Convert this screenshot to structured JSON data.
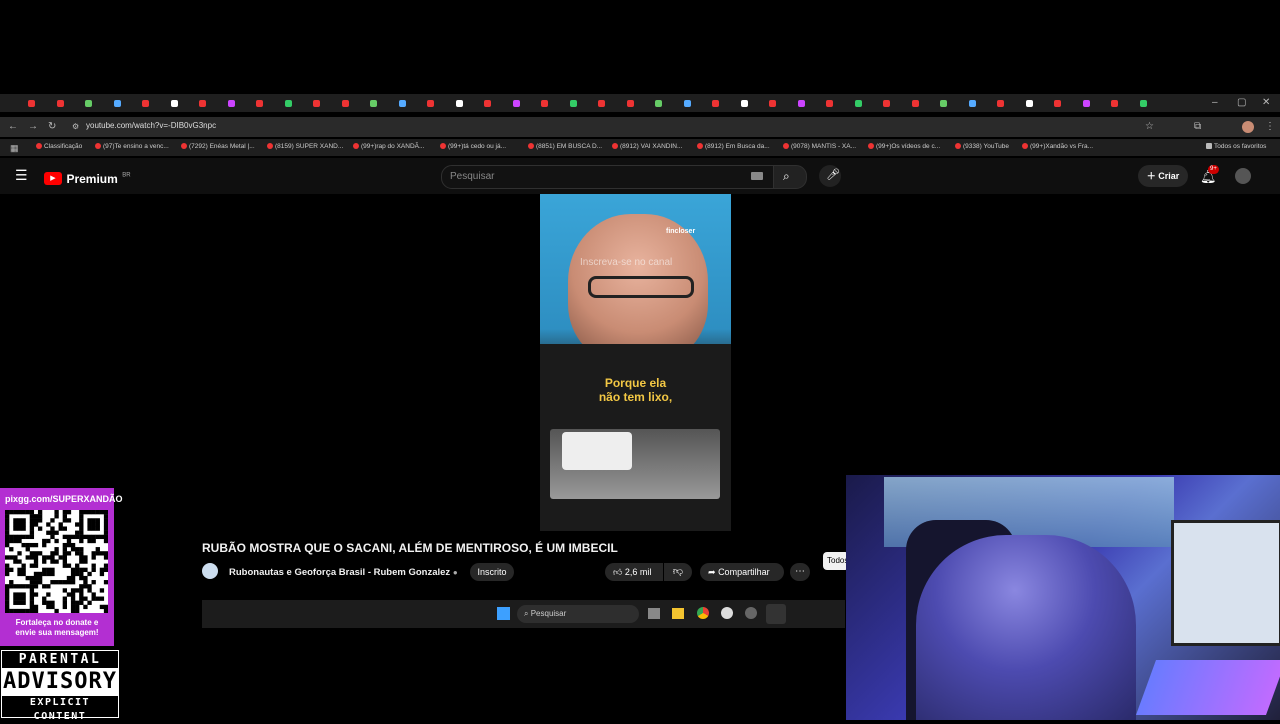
{
  "browser": {
    "url": "youtube.com/watch?v=-DIB0vG3npc",
    "tab_count_visible": 40,
    "bookmarks": [
      {
        "label": "Classificação"
      },
      {
        "label": "(97)Te ensino a venc..."
      },
      {
        "label": "(7292) Enéas Metal |..."
      },
      {
        "label": "(8159) SUPER XAND..."
      },
      {
        "label": "(99+)rap do XANDÃ..."
      },
      {
        "label": "(99+)tá cedo ou já..."
      },
      {
        "label": "(8851) EM BUSCA D..."
      },
      {
        "label": "(8912) VAI XANDIN..."
      },
      {
        "label": "(8912) Em Busca da..."
      },
      {
        "label": "(9078) MANTIS - XA..."
      },
      {
        "label": "(99+)Os vídeos de c..."
      },
      {
        "label": "(9338) YouTube"
      },
      {
        "label": "(99+)Xandão vs Fra..."
      }
    ],
    "all_bookmarks_label": "Todos os favoritos"
  },
  "youtube": {
    "logo_text": "Premium",
    "logo_region": "BR",
    "search_placeholder": "Pesquisar",
    "create_label": "Criar",
    "notifications_badge": "9+",
    "video": {
      "overlay_subscribe": "Inscreva-se no canal",
      "brand_tag": "fincloser",
      "caption_line1": "Porque ela",
      "caption_line2": "não tem lixo,"
    },
    "title": "RUBÃO MOSTRA QUE O SACANI, ALÉM DE MENTIROSO, É UM IMBECIL",
    "channel_name": "Rubonautas e Geoforça Brasil - Rubem Gonzalez",
    "subscribed_label": "Inscrito",
    "likes": "2,6 mil",
    "share_label": "Compartilhar",
    "chip_label": "Todos"
  },
  "taskbar": {
    "search_label": "Pesquisar"
  },
  "donation": {
    "url": "pixgg.com/SUPERXANDÃO",
    "message_line1": "Fortaleça no donate e",
    "message_line2": "envie sua mensagem!"
  },
  "advisory": {
    "line1": "PARENTAL",
    "line2": "ADVISORY",
    "line3": "EXPLICIT CONTENT"
  },
  "colors": {
    "youtube_red": "#ff0000",
    "donation_bg": "#b32fd2",
    "caption_yellow": "#f2c744"
  }
}
